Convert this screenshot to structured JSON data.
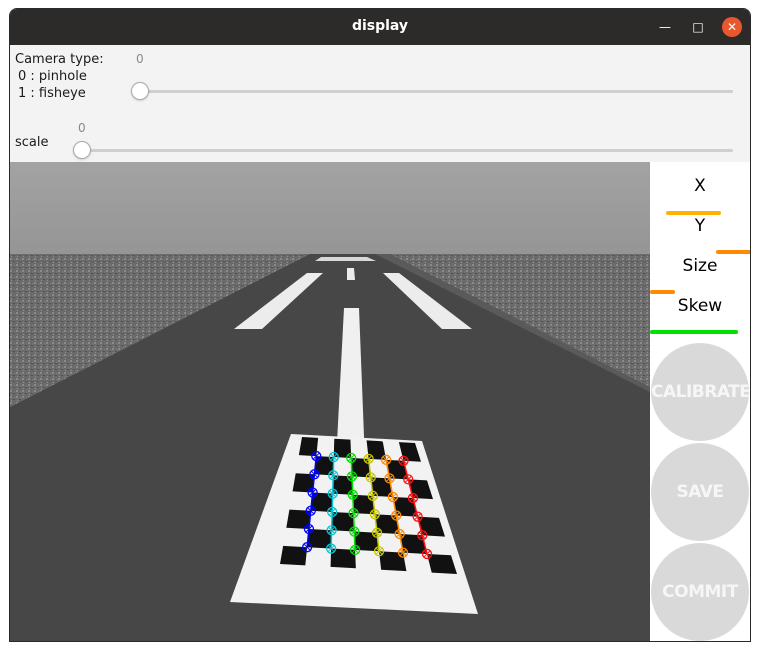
{
  "window": {
    "title": "display"
  },
  "controls": {
    "camera_type": {
      "label": "Camera type:",
      "option0": "0 : pinhole",
      "option1": "1 : fisheye",
      "value": "0",
      "level": 0
    },
    "scale": {
      "label": "scale",
      "value": "0",
      "level": 0
    }
  },
  "sidebar": {
    "metrics": [
      {
        "label": "X",
        "color": "#ffb000",
        "progress": 0.55
      },
      {
        "label": "Y",
        "color": "#ff8a00",
        "progress": 0.38
      },
      {
        "label": "Size",
        "color": "#ff8a00",
        "progress": 0.25
      },
      {
        "label": "Skew",
        "color": "#00e000",
        "progress": 0.88
      }
    ],
    "buttons": {
      "calibrate": "CALIBRATE",
      "save": "SAVE",
      "commit": "COMMIT"
    }
  },
  "colors": {
    "sky": "#999999",
    "road": "#474747",
    "board_columns": [
      "#0000ff",
      "#00c8d8",
      "#00e000",
      "#c8c800",
      "#ff8a00",
      "#ff1010"
    ]
  }
}
